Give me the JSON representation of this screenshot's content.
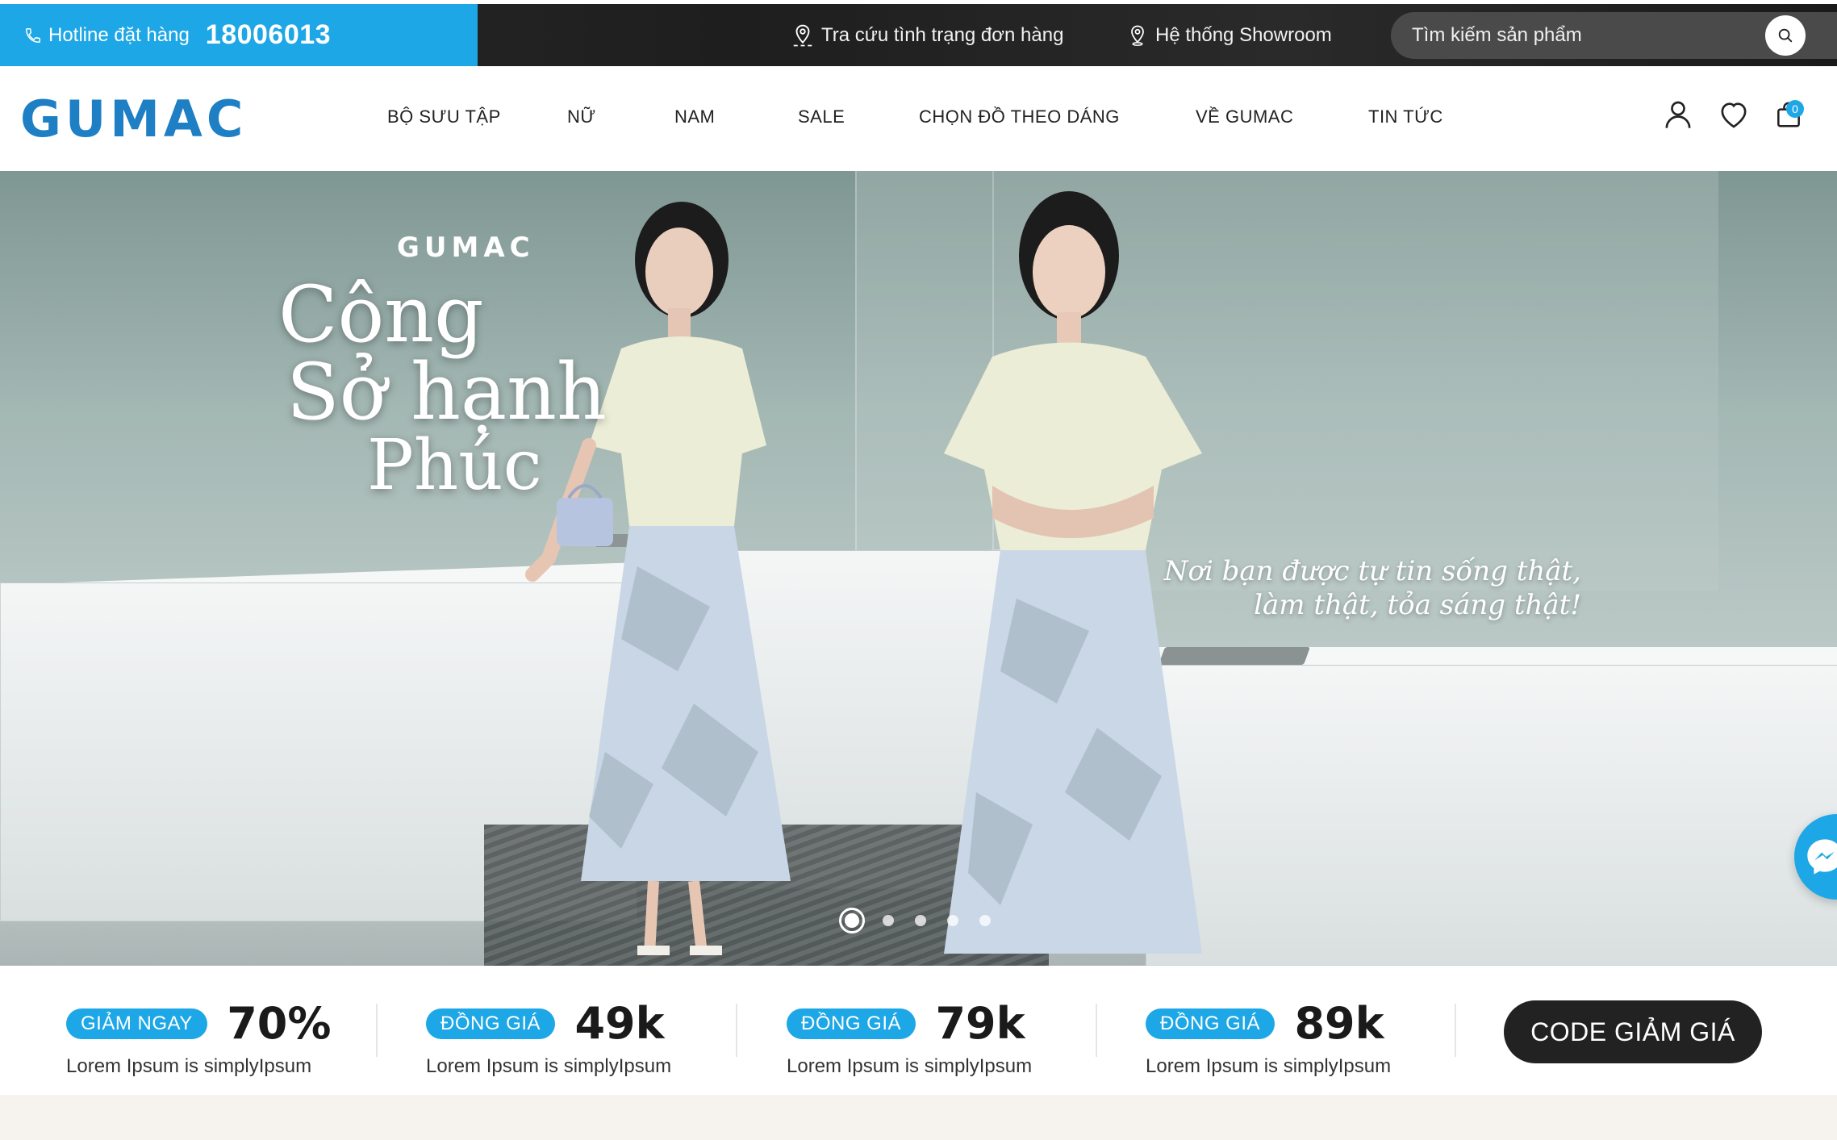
{
  "topbar": {
    "hotline_label": "Hotline đặt hàng",
    "hotline_number": "18006013",
    "track_order": "Tra cứu tình trạng đơn hàng",
    "showroom": "Hệ thống Showroom",
    "search_placeholder": "Tìm kiếm sản phẩm"
  },
  "header": {
    "logo": "GUMAC",
    "nav": [
      "BỘ SƯU TẬP",
      "NỮ",
      "NAM",
      "SALE",
      "CHỌN ĐỒ THEO DÁNG",
      "VỀ GUMAC",
      "TIN TỨC"
    ],
    "cart_count": "0",
    "icons": [
      "user-icon",
      "heart-icon",
      "cart-icon"
    ]
  },
  "hero": {
    "brand": "GUMAC",
    "title_line1": "Công",
    "title_line2": "Sở hạnh",
    "title_line3": "Phúc",
    "tagline_line1": "Nơi bạn được tự tin sống thật,",
    "tagline_line2": "làm thật, tỏa sáng thật!",
    "slides": 5,
    "active_slide": 1
  },
  "promos": [
    {
      "badge": "GIẢM NGAY",
      "value": "70%",
      "desc": "Lorem Ipsum is simplyIpsum"
    },
    {
      "badge": "ĐỒNG GIÁ",
      "value": "49k",
      "desc": "Lorem Ipsum is simplyIpsum"
    },
    {
      "badge": "ĐỒNG GIÁ",
      "value": "79k",
      "desc": "Lorem Ipsum is simplyIpsum"
    },
    {
      "badge": "ĐỒNG GIÁ",
      "value": "89k",
      "desc": "Lorem Ipsum is simplyIpsum"
    }
  ],
  "code_button": "CODE GIẢM GIÁ",
  "colors": {
    "accent": "#1ea7e6",
    "logo": "#1e7fc4",
    "dark": "#222222"
  }
}
